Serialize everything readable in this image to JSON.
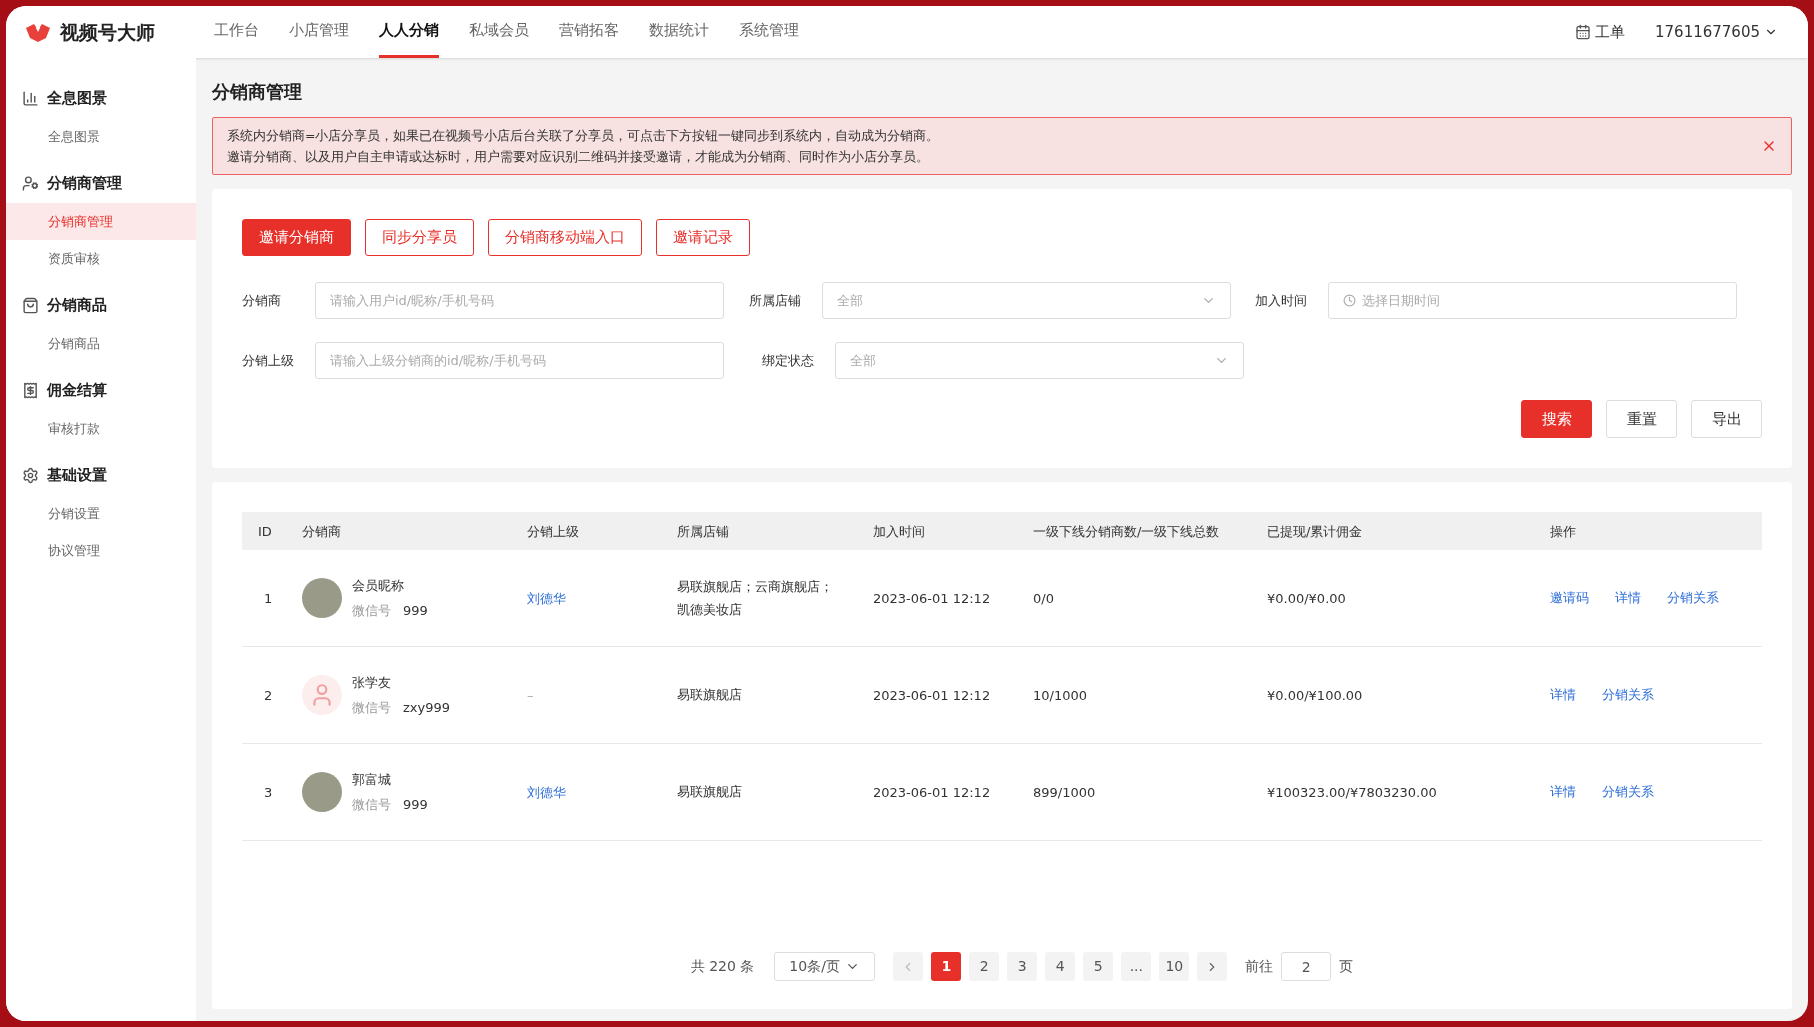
{
  "brand": {
    "name": "视频号大师"
  },
  "nav": [
    {
      "label": "工作台",
      "selected": false
    },
    {
      "label": "小店管理",
      "selected": false
    },
    {
      "label": "人人分销",
      "selected": true
    },
    {
      "label": "私域会员",
      "selected": false
    },
    {
      "label": "营销拓客",
      "selected": false
    },
    {
      "label": "数据统计",
      "selected": false
    },
    {
      "label": "系统管理",
      "selected": false
    }
  ],
  "header_right": {
    "ticket": "工单",
    "account": "17611677605"
  },
  "sidebar": {
    "groups": [
      {
        "title": "全息图景",
        "items": [
          {
            "label": "全息图景",
            "selected": false
          }
        ]
      },
      {
        "title": "分销商管理",
        "items": [
          {
            "label": "分销商管理",
            "selected": true
          },
          {
            "label": "资质审核",
            "selected": false
          }
        ]
      },
      {
        "title": "分销商品",
        "items": [
          {
            "label": "分销商品",
            "selected": false
          }
        ]
      },
      {
        "title": "佣金结算",
        "items": [
          {
            "label": "审核打款",
            "selected": false
          }
        ]
      },
      {
        "title": "基础设置",
        "items": [
          {
            "label": "分销设置",
            "selected": false
          },
          {
            "label": "协议管理",
            "selected": false
          }
        ]
      }
    ]
  },
  "page_title": "分销商管理",
  "alert": {
    "lines": [
      "系统内分销商=小店分享员，如果已在视频号小店后台关联了分享员，可点击下方按钮一键同步到系统内，自动成为分销商。",
      "邀请分销商、以及用户自主申请或达标时，用户需要对应识别二维码并接受邀请，才能成为分销商、同时作为小店分享员。"
    ]
  },
  "actions": [
    {
      "label": "邀请分销商",
      "kind": "primary"
    },
    {
      "label": "同步分享员",
      "kind": "outline"
    },
    {
      "label": "分销商移动端入口",
      "kind": "outline"
    },
    {
      "label": "邀请记录",
      "kind": "outline"
    }
  ],
  "filters": [
    [
      {
        "label": "分销商",
        "kind": "input",
        "placeholder": "请输入用户id/昵称/手机号码"
      },
      {
        "label": "所属店铺",
        "kind": "select",
        "value": "全部"
      },
      {
        "label": "加入时间",
        "kind": "date",
        "placeholder": "选择日期时间"
      }
    ],
    [
      {
        "label": "分销上级",
        "kind": "input",
        "placeholder": "请输入上级分销商的id/昵称/手机号码"
      },
      {
        "label": "绑定状态",
        "kind": "select",
        "value": "全部"
      }
    ]
  ],
  "filter_buttons": [
    {
      "label": "搜索",
      "kind": "primary"
    },
    {
      "label": "重置",
      "kind": "plain"
    },
    {
      "label": "导出",
      "kind": "plain"
    }
  ],
  "table": {
    "columns": [
      "ID",
      "分销商",
      "分销上级",
      "所属店铺",
      "加入时间",
      "一级下线分销商数/一级下线总数",
      "已提现/累计佣金",
      "操作"
    ],
    "rows": [
      {
        "id": "1",
        "name": "会员昵称",
        "wechat_label": "微信号",
        "wechat": "999",
        "avatar": {
          "kind": "photo"
        },
        "superior": {
          "text": "刘德华",
          "kind": "link"
        },
        "stores": [
          "易联旗舰店；云商旗舰店；",
          "凯德美妆店"
        ],
        "joined": "2023-06-01 12:12",
        "downline": "0/0",
        "commission": "¥0.00/¥0.00",
        "ops": [
          "邀请码",
          "详情",
          "分销关系"
        ]
      },
      {
        "id": "2",
        "name": "张学友",
        "wechat_label": "微信号",
        "wechat": "zxy999",
        "avatar": {
          "kind": "default"
        },
        "superior": {
          "text": "–",
          "kind": "empty"
        },
        "stores": [
          "易联旗舰店"
        ],
        "joined": "2023-06-01 12:12",
        "downline": "10/1000",
        "commission": "¥0.00/¥100.00",
        "ops": [
          "详情",
          "分销关系"
        ]
      },
      {
        "id": "3",
        "name": "郭富城",
        "wechat_label": "微信号",
        "wechat": "999",
        "avatar": {
          "kind": "photo"
        },
        "superior": {
          "text": "刘德华",
          "kind": "link"
        },
        "stores": [
          "易联旗舰店"
        ],
        "joined": "2023-06-01 12:12",
        "downline": "899/1000",
        "commission": "¥100323.00/¥7803230.00",
        "ops": [
          "详情",
          "分销关系"
        ]
      }
    ]
  },
  "pagination": {
    "total": "共 220 条",
    "page_size": "10条/页",
    "pages": [
      {
        "label": "1",
        "selected": true
      },
      {
        "label": "2",
        "selected": false
      },
      {
        "label": "3",
        "selected": false
      },
      {
        "label": "4",
        "selected": false
      },
      {
        "label": "5",
        "selected": false
      },
      {
        "label": "...",
        "selected": false
      },
      {
        "label": "10",
        "selected": false
      }
    ],
    "goto_label": "前往",
    "goto_value": "2",
    "goto_suffix": "页"
  }
}
